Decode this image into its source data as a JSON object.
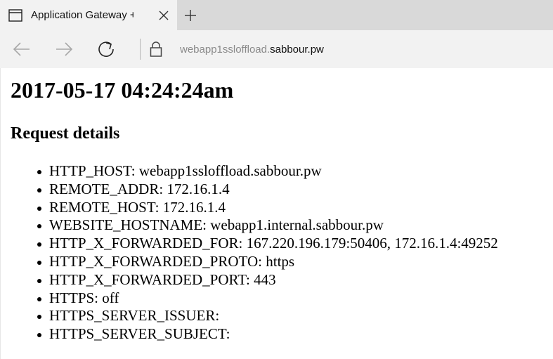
{
  "browser": {
    "tab": {
      "title": "Application Gateway + App Service",
      "icon": "browser-tab-icon",
      "close_icon": "close-icon"
    },
    "new_tab_icon": "plus-icon",
    "nav": {
      "back_icon": "back-arrow-icon",
      "forward_icon": "forward-arrow-icon",
      "refresh_icon": "refresh-icon",
      "lock_icon": "lock-icon"
    },
    "address": {
      "subdomain": "webapp1ssloffload.",
      "domain": "sabbour.pw"
    }
  },
  "page": {
    "timestamp": "2017-05-17 04:24:24am",
    "heading": "Request details",
    "details": [
      {
        "label": "HTTP_HOST: webapp1ssloffload.sabbour.pw"
      },
      {
        "label": "REMOTE_ADDR: 172.16.1.4"
      },
      {
        "label": "REMOTE_HOST: 172.16.1.4"
      },
      {
        "label": "WEBSITE_HOSTNAME: webapp1.internal.sabbour.pw"
      },
      {
        "label": "HTTP_X_FORWARDED_FOR: 167.220.196.179:50406, 172.16.1.4:49252"
      },
      {
        "label": "HTTP_X_FORWARDED_PROTO: https"
      },
      {
        "label": "HTTP_X_FORWARDED_PORT: 443"
      },
      {
        "label": "HTTPS: off"
      },
      {
        "label": "HTTPS_SERVER_ISSUER:"
      },
      {
        "label": "HTTPS_SERVER_SUBJECT:"
      }
    ]
  }
}
